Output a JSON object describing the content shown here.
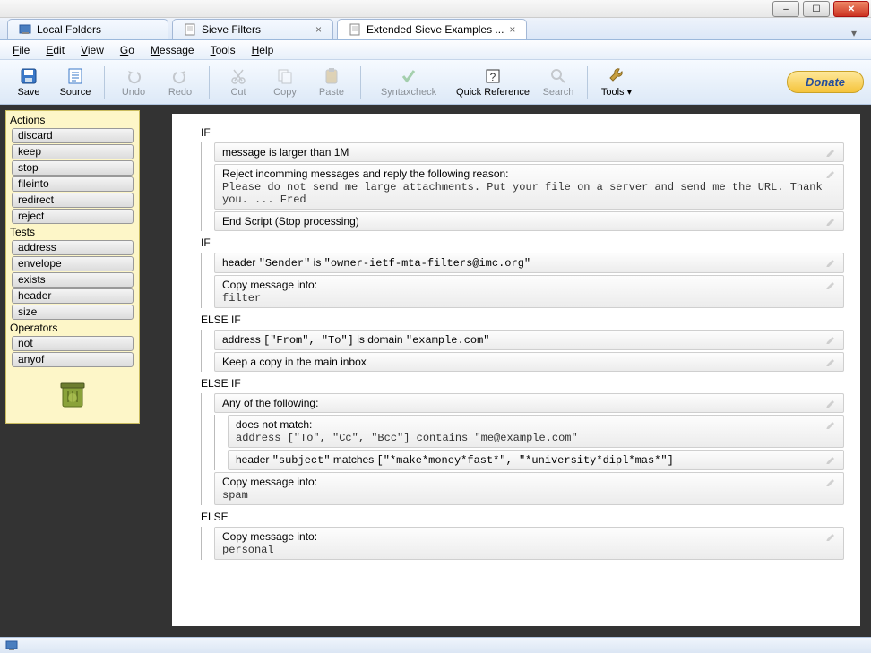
{
  "window": {
    "minimize": "–",
    "maximize": "☐",
    "close": "✕"
  },
  "tabs": [
    {
      "label": "Local Folders",
      "closable": false,
      "active": false,
      "icon": "folder"
    },
    {
      "label": "Sieve Filters",
      "closable": true,
      "active": false,
      "icon": "doc"
    },
    {
      "label": "Extended Sieve Examples ...",
      "closable": true,
      "active": true,
      "icon": "doc"
    }
  ],
  "menus": [
    "File",
    "Edit",
    "View",
    "Go",
    "Message",
    "Tools",
    "Help"
  ],
  "toolbar": [
    {
      "id": "save",
      "label": "Save",
      "icon": "save",
      "enabled": true
    },
    {
      "id": "source",
      "label": "Source",
      "icon": "source",
      "enabled": true
    },
    {
      "sep": true
    },
    {
      "id": "undo",
      "label": "Undo",
      "icon": "undo",
      "enabled": false
    },
    {
      "id": "redo",
      "label": "Redo",
      "icon": "redo",
      "enabled": false
    },
    {
      "sep": true
    },
    {
      "id": "cut",
      "label": "Cut",
      "icon": "cut",
      "enabled": false
    },
    {
      "id": "copy",
      "label": "Copy",
      "icon": "copy",
      "enabled": false
    },
    {
      "id": "paste",
      "label": "Paste",
      "icon": "paste",
      "enabled": false
    },
    {
      "sep": true
    },
    {
      "id": "syntax",
      "label": "Syntaxcheck",
      "icon": "check",
      "enabled": false,
      "wide": true
    },
    {
      "id": "quickref",
      "label": "Quick Reference",
      "icon": "ref",
      "enabled": true,
      "wide": true
    },
    {
      "id": "search",
      "label": "Search",
      "icon": "search",
      "enabled": false
    },
    {
      "sep": true
    },
    {
      "id": "tools",
      "label": "Tools",
      "icon": "tools",
      "enabled": true,
      "dropdown": true
    }
  ],
  "donate": "Donate",
  "sidebar": {
    "groups": [
      {
        "title": "Actions",
        "items": [
          "discard",
          "keep",
          "stop",
          "fileinto",
          "redirect",
          "reject"
        ]
      },
      {
        "title": "Tests",
        "items": [
          "address",
          "envelope",
          "exists",
          "header",
          "size"
        ]
      },
      {
        "title": "Operators",
        "items": [
          "not",
          "anyof"
        ]
      }
    ]
  },
  "script": [
    {
      "type": "if",
      "label": "IF",
      "children": [
        {
          "kind": "cond",
          "text": "message is larger than 1M"
        },
        {
          "kind": "action",
          "text": "Reject incomming messages and reply the following reason:",
          "mono": "Please do not send me large attachments. Put your file on a server and send me the URL. Thank you. ... Fred"
        },
        {
          "kind": "action",
          "text": "End Script (Stop processing)"
        }
      ]
    },
    {
      "type": "if",
      "label": "IF",
      "children": [
        {
          "kind": "cond",
          "html": "header <mono>\"Sender\"</mono> is <mono>\"owner-ietf-mta-filters@imc.org\"</mono>"
        },
        {
          "kind": "action",
          "text": "Copy message into:",
          "mono": "filter"
        }
      ]
    },
    {
      "type": "elseif",
      "label": "ELSE IF",
      "children": [
        {
          "kind": "cond",
          "html": "address <mono>[\"From\", \"To\"]</mono> is domain <mono>\"example.com\"</mono>"
        },
        {
          "kind": "action",
          "text": "Keep a copy in the main inbox"
        }
      ]
    },
    {
      "type": "elseif",
      "label": "ELSE IF",
      "children": [
        {
          "kind": "cond",
          "text": "Any of the following:"
        },
        {
          "kind": "sub",
          "children": [
            {
              "kind": "action",
              "text": "does not match:",
              "html2": "address <mono>[\"To\", \"Cc\", \"Bcc\"]</mono> contains <mono>\"me@example.com\"</mono>"
            },
            {
              "kind": "action",
              "html": "header <mono>\"subject\"</mono> matches <mono>[\"*make*money*fast*\", \"*university*dipl*mas*\"]</mono>"
            }
          ]
        },
        {
          "kind": "action",
          "text": "Copy message into:",
          "mono": "spam"
        }
      ]
    },
    {
      "type": "else",
      "label": "ELSE",
      "children": [
        {
          "kind": "action",
          "text": "Copy message into:",
          "mono": "personal"
        }
      ]
    }
  ]
}
